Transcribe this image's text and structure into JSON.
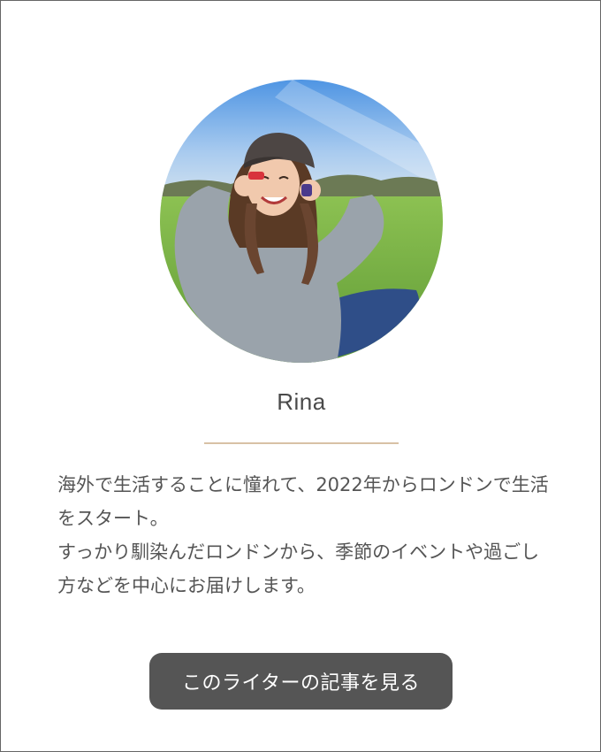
{
  "profile": {
    "name": "Rina",
    "bio_lines": [
      "海外で生活することに憧れて、2022年からロンドンで生活をスタート。",
      "すっかり馴染んだロンドンから、季節のイベントや過ごし方などを中心にお届けします。"
    ],
    "photo_icon": "profile-photo-icon"
  },
  "cta": {
    "label": "このライターの記事を見る"
  },
  "colors": {
    "divider": "#d8c1a5",
    "button_bg": "#555555",
    "text": "#555555",
    "sky": "#6aa7e6",
    "grass": "#7fb548"
  }
}
